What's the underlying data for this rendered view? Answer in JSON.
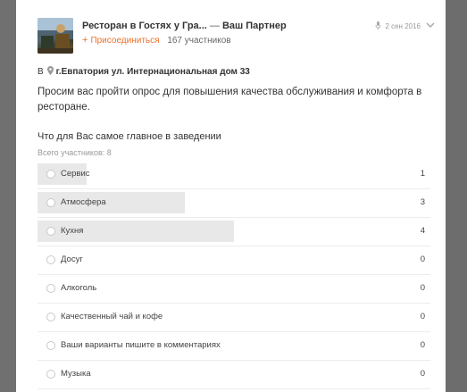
{
  "post": {
    "group_name": "Ресторан в Гостях у Гра...",
    "separator": "—",
    "partner_label": "Ваш Партнер",
    "join_label": "Присоединиться",
    "members": "167 участников",
    "date": "2 сен 2016",
    "location_prefix": "В",
    "location_place": "г.Евпатория ул. Интернациональная дом 33",
    "description": "Просим вас пройти опрос для повышения качества обслуживания и комфорта в ресторане."
  },
  "poll": {
    "question": "Что для Вас самое главное в заведении",
    "total": "Всего участников: 8",
    "options": [
      {
        "label": "Сервис",
        "count": "1",
        "share": 0.125
      },
      {
        "label": "Атмосфера",
        "count": "3",
        "share": 0.375
      },
      {
        "label": "Кухня",
        "count": "4",
        "share": 0.5
      },
      {
        "label": "Досуг",
        "count": "0",
        "share": 0
      },
      {
        "label": "Алкоголь",
        "count": "0",
        "share": 0
      },
      {
        "label": "Качественный чай и кофе",
        "count": "0",
        "share": 0
      },
      {
        "label": "Ваши варианты пишите в комментариях",
        "count": "0",
        "share": 0
      },
      {
        "label": "Музыка",
        "count": "0",
        "share": 0
      }
    ]
  },
  "icons": {
    "join": "plus-icon",
    "location": "map-pin-icon",
    "meta": "microphone-icon",
    "menu": "chevron-down-icon"
  },
  "colors": {
    "accent": "#eb722e",
    "bar_fill": "#e8e8e8",
    "backdrop": "#6f6f6f"
  }
}
